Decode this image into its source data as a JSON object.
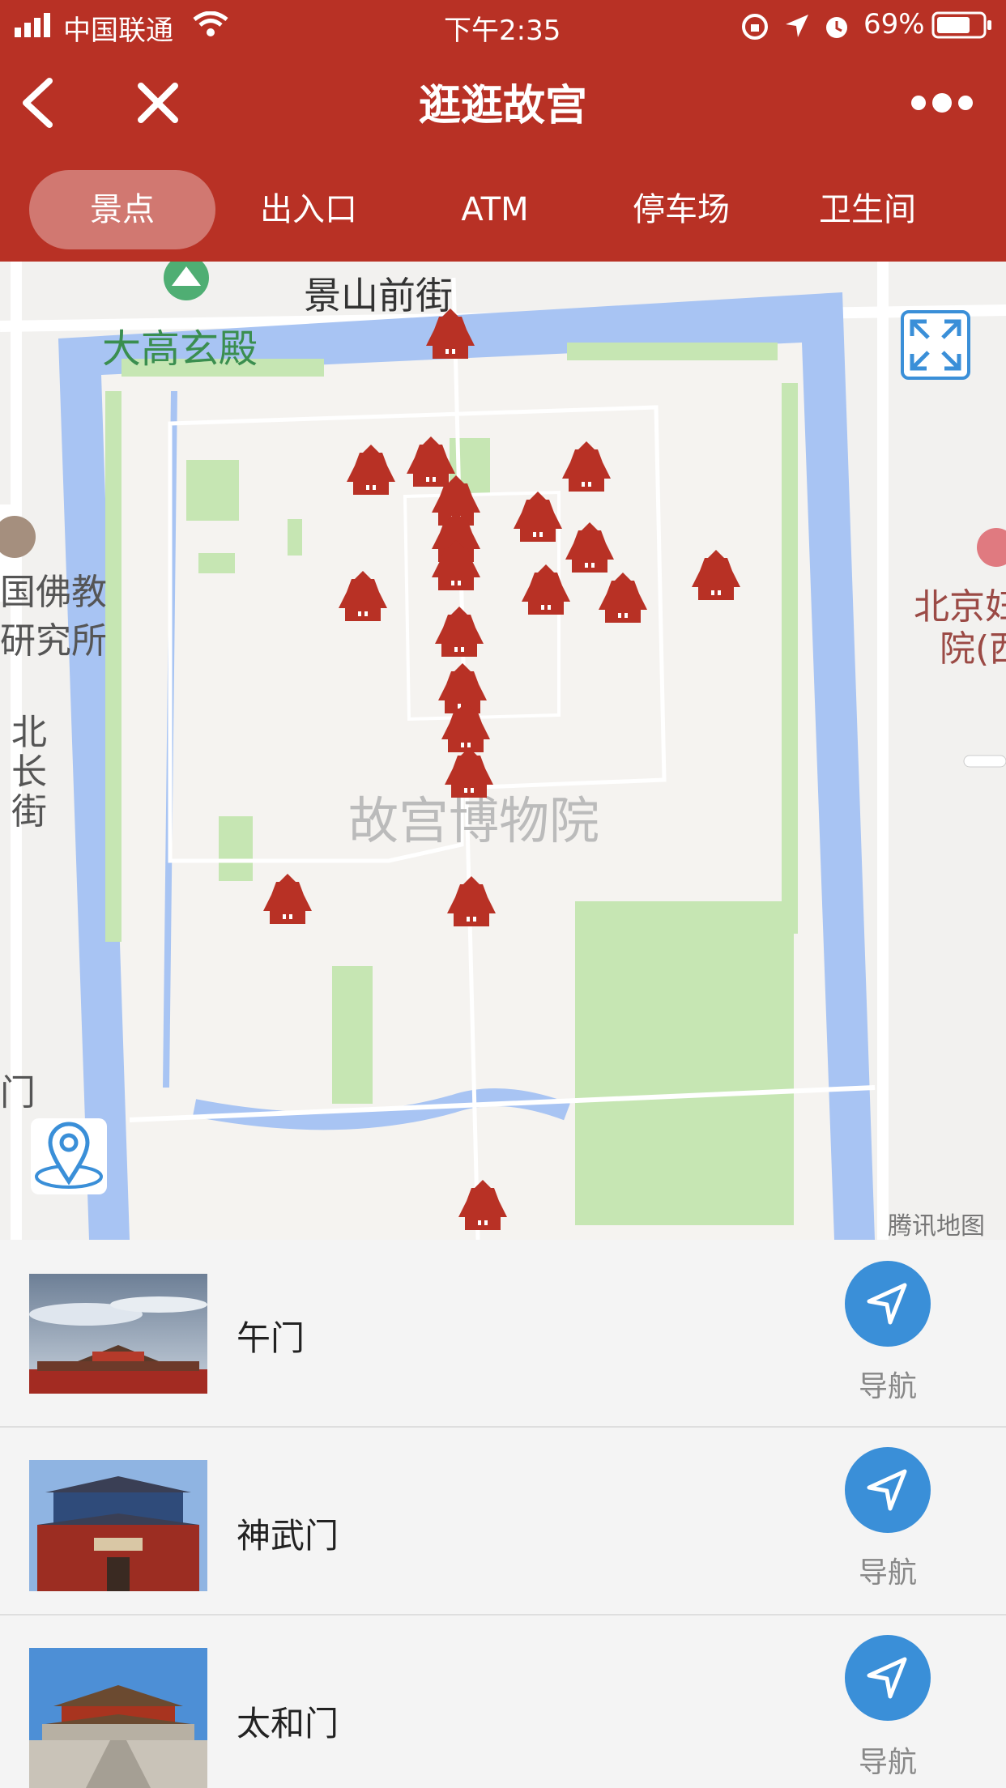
{
  "status_bar": {
    "carrier": "中国联通",
    "time": "下午2:35",
    "battery": "69%"
  },
  "header": {
    "title": "逛逛故宫",
    "back_icon": "back-chevron-icon",
    "close_icon": "close-icon",
    "more_icon": "more-dots-icon"
  },
  "tabs": [
    {
      "label": "景点",
      "active": true
    },
    {
      "label": "出入口",
      "active": false
    },
    {
      "label": "ATM",
      "active": false
    },
    {
      "label": "停车场",
      "active": false
    },
    {
      "label": "卫生间",
      "active": false
    }
  ],
  "map": {
    "labels": {
      "jingshan": "景山前街",
      "dagao": "大高玄殿",
      "museum": "故宫博物院",
      "buddhist_1": "国佛教",
      "buddhist_2": "研究所",
      "beichang_1": "北",
      "beichang_2": "长",
      "beichang_3": "街",
      "hospital_1": "北京妇",
      "hospital_2": "院(西",
      "gate_fragment": "门",
      "watermark": "腾讯地图"
    },
    "colors": {
      "water": "#a8c4f3",
      "park": "#c6e6b3",
      "ground": "#f5f3f0",
      "marker": "#b83125"
    }
  },
  "list": [
    {
      "name": "午门",
      "nav_label": "导航"
    },
    {
      "name": "神武门",
      "nav_label": "导航"
    },
    {
      "name": "太和门",
      "nav_label": "导航"
    }
  ]
}
